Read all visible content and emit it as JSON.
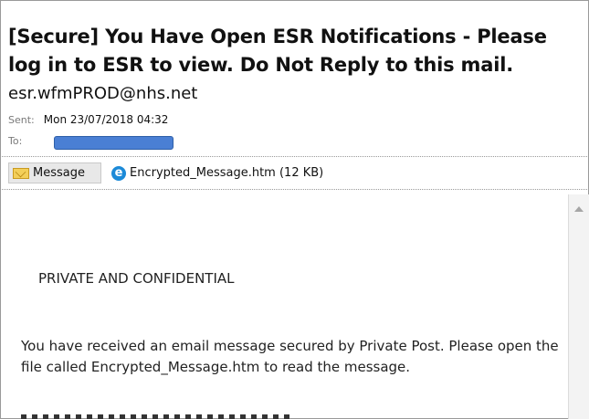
{
  "email": {
    "subject": "[Secure] You Have Open ESR Notifications - Please log in to ESR to view. Do Not Reply to this mail.",
    "from": "esr.wfmPROD@nhs.net",
    "sent_label": "Sent:",
    "sent_value": "Mon 23/07/2018 04:32",
    "to_label": "To:"
  },
  "attachments": {
    "message_tab_label": "Message",
    "file_label": "Encrypted_Message.htm (12 KB)",
    "icons": [
      "envelope-icon",
      "internet-explorer-icon"
    ]
  },
  "body": {
    "heading": "PRIVATE AND CONFIDENTIAL",
    "paragraph": "You have received an email message secured by Private Post. Please open the file called Encrypted_Message.htm to read the message."
  },
  "colors": {
    "redaction": "#4a7fd4",
    "envelope": "#f3cf5a",
    "ie_blue": "#1c8ad8"
  }
}
